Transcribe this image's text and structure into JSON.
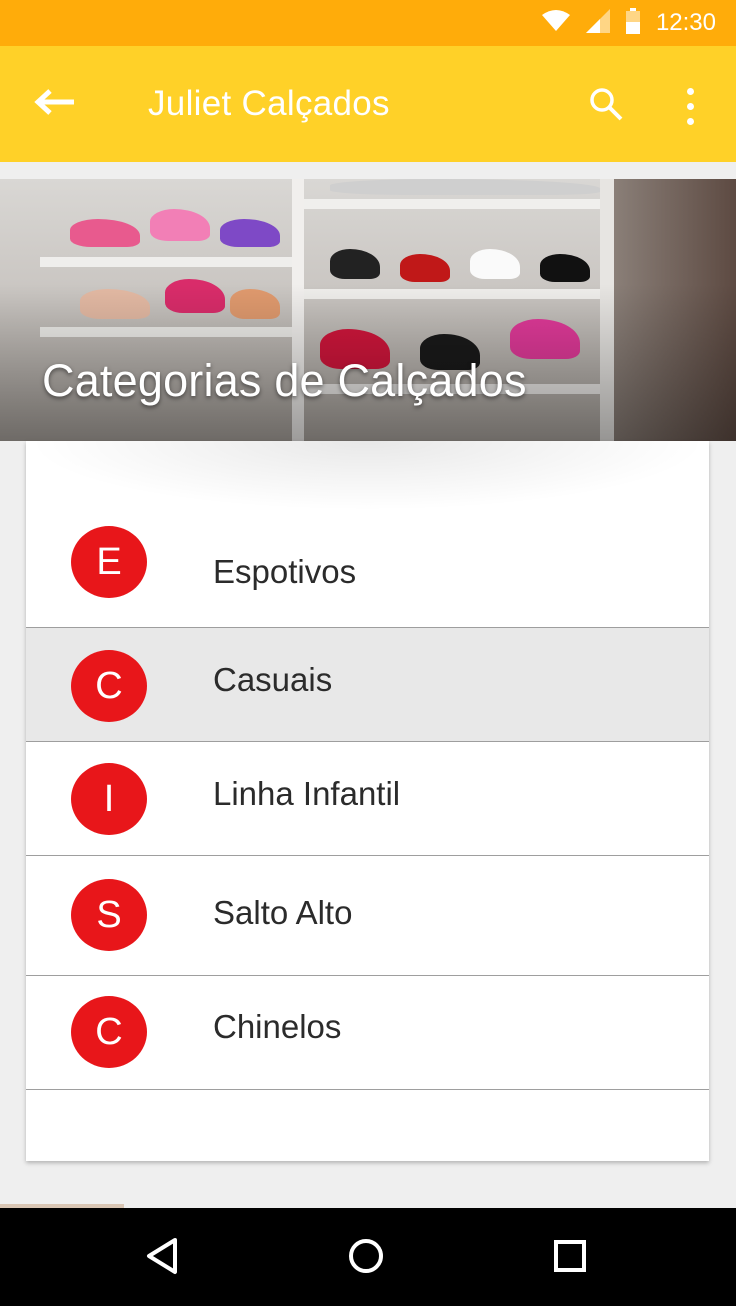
{
  "status_bar": {
    "time": "12:30",
    "icons": [
      "wifi-icon",
      "signal-icon",
      "battery-icon"
    ],
    "color": "#FFAC0A"
  },
  "app_bar": {
    "title": "Juliet Calçados",
    "color": "#FFD128",
    "icons": [
      "back-arrow-icon",
      "search-icon",
      "more-vert-icon"
    ]
  },
  "header": {
    "title": "Categorias de Calçados"
  },
  "categories": [
    {
      "initial": "E",
      "label": "Espotivos",
      "selected": false
    },
    {
      "initial": "C",
      "label": "Casuais",
      "selected": true
    },
    {
      "initial": "I",
      "label": "Linha Infantil",
      "selected": false
    },
    {
      "initial": "S",
      "label": "Salto Alto",
      "selected": false
    },
    {
      "initial": "C",
      "label": "Chinelos",
      "selected": false
    }
  ],
  "colors": {
    "avatar": "#E8161A",
    "selected_row": "#E8E8E8"
  },
  "nav_bar": {
    "icons": [
      "back-triangle-icon",
      "home-circle-icon",
      "recents-square-icon"
    ]
  }
}
